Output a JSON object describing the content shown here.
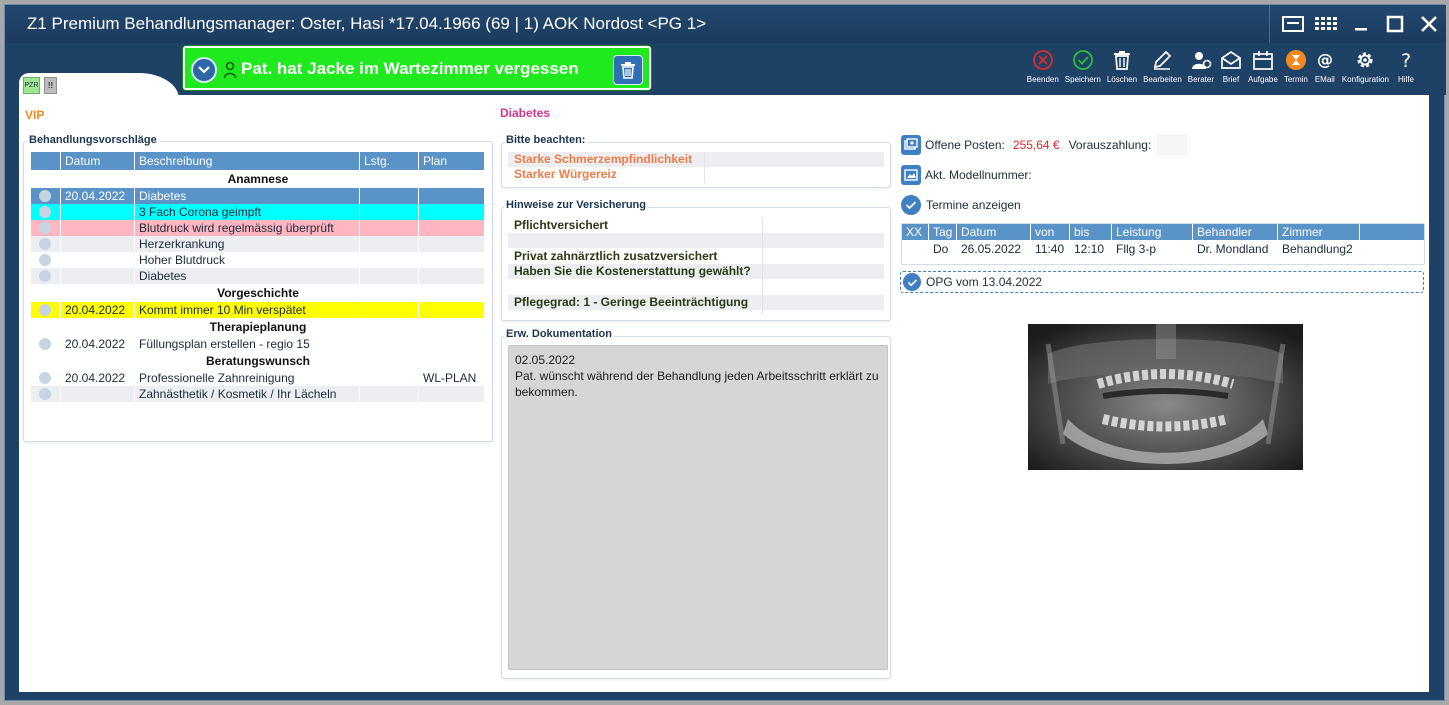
{
  "window": {
    "title": "Z1 Premium Behandlungsmanager:  Oster, Hasi *17.04.1966 (69 |  1) AOK Nordost <PG 1>"
  },
  "tabs": {
    "pzr": "PZR",
    "second": "!!"
  },
  "alert": {
    "text": "Pat. hat Jacke im Wartezimmer vergessen",
    "color": "#1eea1e"
  },
  "toolbar": {
    "items": [
      {
        "label": "Beenden",
        "icon": "close-circle-icon"
      },
      {
        "label": "Speichern",
        "icon": "check-circle-icon"
      },
      {
        "label": "Löschen",
        "icon": "trash-icon"
      },
      {
        "label": "Bearbeiten",
        "icon": "pencil-icon"
      },
      {
        "label": "Berater",
        "icon": "user-gear-icon"
      },
      {
        "label": "Brief",
        "icon": "envelope-icon"
      },
      {
        "label": "Aufgabe",
        "icon": "calendar-icon"
      },
      {
        "label": "Termin",
        "icon": "hourglass-icon"
      },
      {
        "label": "EMail",
        "icon": "at-icon"
      },
      {
        "label": "Konfiguration",
        "icon": "gear-icon"
      },
      {
        "label": "Hilfe",
        "icon": "question-icon"
      }
    ]
  },
  "left": {
    "vip": "VIP",
    "section_title": "Behandlungsvorschläge",
    "columns": [
      "",
      "Datum",
      "Beschreibung",
      "Lstg.",
      "Plan"
    ],
    "groups": [
      {
        "title": "Anamnese",
        "rows": [
          {
            "date": "20.04.2022",
            "desc": "Diabetes",
            "lstg": "",
            "plan": "",
            "bg": "#5a93c8",
            "fg": "#ffffff"
          },
          {
            "date": "",
            "desc": "3 Fach Corona geimpft",
            "lstg": "",
            "plan": "",
            "bg": "#00ffff",
            "fg": "#1b2b3b"
          },
          {
            "date": "",
            "desc": "Blutdruck wird regelmässig überprüft",
            "lstg": "",
            "plan": "",
            "bg": "#ffb6c1",
            "fg": "#1b2b3b"
          },
          {
            "date": "",
            "desc": "Herzerkrankung",
            "lstg": "",
            "plan": "",
            "bg": "#eceef1",
            "fg": "#1b2b3b"
          },
          {
            "date": "",
            "desc": "Hoher Blutdruck",
            "lstg": "",
            "plan": "",
            "bg": "#ffffff",
            "fg": "#1b2b3b"
          },
          {
            "date": "",
            "desc": "Diabetes",
            "lstg": "",
            "plan": "",
            "bg": "#eceef1",
            "fg": "#1b2b3b"
          }
        ]
      },
      {
        "title": "Vorgeschichte",
        "rows": [
          {
            "date": "20.04.2022",
            "desc": "Kommt immer 10 Min verspätet",
            "lstg": "",
            "plan": "",
            "bg": "#ffff00",
            "fg": "#1b2b3b"
          }
        ]
      },
      {
        "title": "Therapieplanung",
        "rows": [
          {
            "date": "20.04.2022",
            "desc": "Füllungsplan erstellen - regio  15",
            "lstg": "",
            "plan": "",
            "bg": "#ffffff",
            "fg": "#1b2b3b"
          }
        ]
      },
      {
        "title": "Beratungswunsch",
        "rows": [
          {
            "date": "20.04.2022",
            "desc": "Professionelle Zahnreinigung",
            "lstg": "",
            "plan": "WL-PLAN",
            "bg": "#ffffff",
            "fg": "#1b2b3b"
          },
          {
            "date": "",
            "desc": "Zahnästhetik / Kosmetik / Ihr Lächeln",
            "lstg": "",
            "plan": "",
            "bg": "#eceef1",
            "fg": "#1b2b3b"
          }
        ]
      }
    ]
  },
  "middle": {
    "diagnosis": "Diabetes",
    "bitte_title": "Bitte beachten:",
    "bitte_items": [
      "Starke Schmerzempfindlichkeit",
      "Starker Würgereiz"
    ],
    "hinweise_title": "Hinweise zur Versicherung",
    "hinweise_lines": [
      "Pflichtversichert",
      "",
      "Privat zahnärztlich zusatzversichert",
      "Haben Sie die Kostenerstattung gewählt?",
      "",
      "Pflegegrad: 1 - Geringe Beeinträchtigung"
    ],
    "doku_title": "Erw. Dokumentation",
    "doku_date": "02.05.2022",
    "doku_text": "Pat. wünscht während der Behandlung jeden Arbeitsschritt erklärt zu bekommen."
  },
  "right": {
    "offene_label": "Offene Posten:",
    "offene_value": "255,64 €",
    "voraus_label": "Vorauszahlung:",
    "voraus_value": "",
    "modell_label": "Akt. Modellnummer:",
    "modell_value": "",
    "termine_label": "Termine anzeigen",
    "termine_columns": [
      "XX",
      "Tag",
      "Datum",
      "von",
      "bis",
      "Leistung",
      "Behandler",
      "Zimmer"
    ],
    "termine_rows": [
      {
        "xx": "",
        "tag": "Do",
        "datum": "26.05.2022",
        "von": "11:40",
        "bis": "12:10",
        "leistung": "Fllg 3-p",
        "behandler": "Dr. Mondland",
        "zimmer": "Behandlung2"
      }
    ],
    "opg_label": "OPG vom 13.04.2022"
  }
}
